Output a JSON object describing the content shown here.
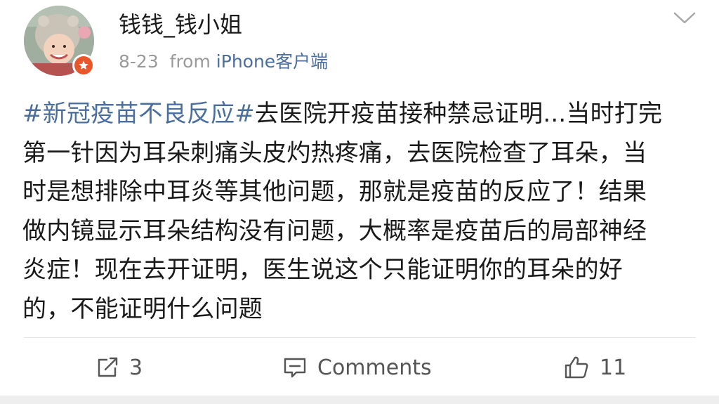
{
  "post": {
    "username": "钱钱_钱小姐",
    "date": "8-23",
    "from_label": "from",
    "client": "iPhone客户端",
    "lines": [
      {
        "tag": "#新冠疫苗不良反应#",
        "text": "去医院开疫苗接种禁忌证明...当时打完"
      },
      {
        "text": "第一针因为耳朵刺痛头皮灼热疼痛，去医院检查了耳朵，当"
      },
      {
        "text": "时是想排除中耳炎等其他问题，那就是疫苗的反应了！结果"
      },
      {
        "text": "做内镜显示耳朵结构没有问题，大概率是疫苗后的局部神经"
      },
      {
        "text": "炎症！现在去开证明，医生说这个只能证明你的耳朵的好"
      },
      {
        "text": "的，不能证明什么问题"
      }
    ]
  },
  "actions": {
    "share_count": "3",
    "comments_label": "Comments",
    "like_count": "11"
  },
  "icons": {
    "share": "share-icon",
    "comment": "comment-icon",
    "like": "thumbs-up-icon",
    "more": "chevron-down-icon",
    "badge": "verified-star-badge-icon"
  },
  "colors": {
    "link": "#4a6f9f",
    "badge": "#e8572a"
  }
}
